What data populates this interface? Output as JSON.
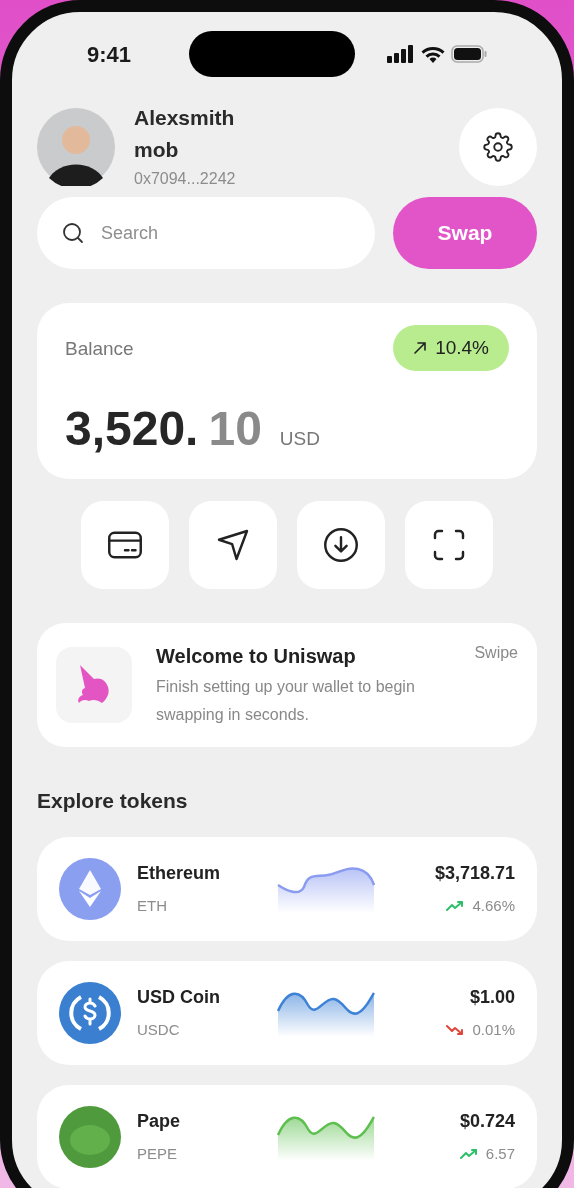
{
  "status_bar": {
    "time": "9:41"
  },
  "profile": {
    "name": "Alexsmith",
    "handle": "mob",
    "address": "0x7094...2242"
  },
  "search": {
    "placeholder": "Search"
  },
  "swap_button": "Swap",
  "balance": {
    "label": "Balance",
    "change": "10.4%",
    "whole": "3,520.",
    "cents": "10",
    "currency": "USD"
  },
  "actions": [
    {
      "kind": "card"
    },
    {
      "kind": "send"
    },
    {
      "kind": "receive"
    },
    {
      "kind": "scan"
    }
  ],
  "welcome": {
    "title": "Welcome to Uniswap",
    "text": "Finish setting up your wallet to begin swapping in seconds.",
    "hint": "Swipe"
  },
  "explore": {
    "title": "Explore tokens"
  },
  "tokens": [
    {
      "kind": "eth",
      "name": "Ethereum",
      "symbol": "ETH",
      "price": "$3,718.71",
      "change": "4.66%",
      "rising": true,
      "color": "#8a9cf0"
    },
    {
      "kind": "usdc",
      "name": "USD Coin",
      "symbol": "USDC",
      "price": "$1.00",
      "change": "0.01%",
      "rising": false,
      "color": "#3d82d6"
    },
    {
      "kind": "pepe",
      "name": "Pape",
      "symbol": "PEPE",
      "price": "$0.724",
      "change": "6.57",
      "rising": true,
      "color": "#5cbf4e"
    }
  ]
}
